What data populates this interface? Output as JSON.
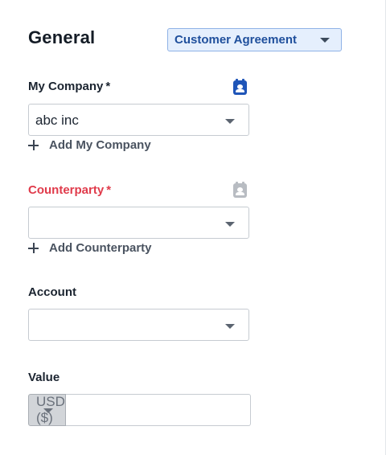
{
  "header": {
    "title": "General",
    "agreement_type": "Customer Agreement"
  },
  "fields": {
    "my_company": {
      "label": "My Company",
      "required_mark": "*",
      "value": "abc inc",
      "add_label": "Add My Company",
      "icon": "contact-card-icon",
      "icon_state": "active"
    },
    "counterparty": {
      "label": "Counterparty",
      "required_mark": "*",
      "value": "",
      "add_label": "Add Counterparty",
      "icon": "contact-card-icon",
      "icon_state": "disabled",
      "state": "error"
    },
    "account": {
      "label": "Account",
      "value": ""
    },
    "value": {
      "label": "Value",
      "currency": "USD ($)",
      "amount": ""
    }
  },
  "colors": {
    "accent": "#1f55b8",
    "error": "#e03b4b",
    "chip_bg": "#e5effd",
    "disabled_bg": "#d2d5d9"
  }
}
